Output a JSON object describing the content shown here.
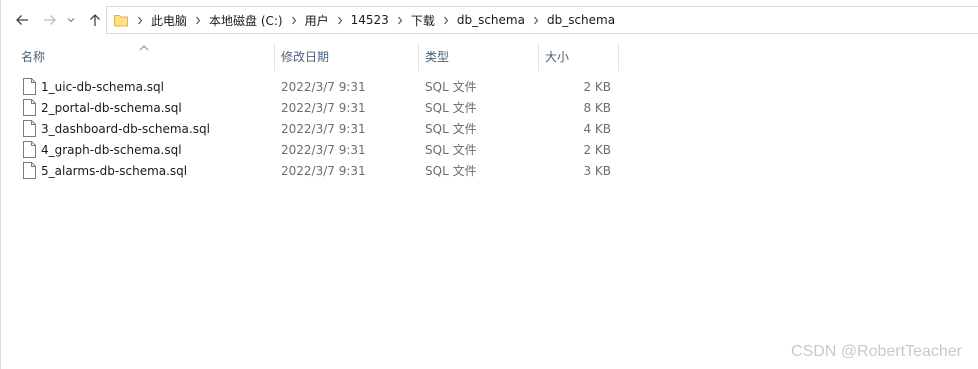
{
  "nav": {
    "breadcrumbs": [
      "此电脑",
      "本地磁盘 (C:)",
      "用户",
      "14523",
      "下载",
      "db_schema",
      "db_schema"
    ]
  },
  "columns": {
    "name": "名称",
    "date": "修改日期",
    "type": "类型",
    "size": "大小",
    "sort_column": "name"
  },
  "files": [
    {
      "name": "1_uic-db-schema.sql",
      "date": "2022/3/7 9:31",
      "type": "SQL 文件",
      "size": "2 KB"
    },
    {
      "name": "2_portal-db-schema.sql",
      "date": "2022/3/7 9:31",
      "type": "SQL 文件",
      "size": "8 KB"
    },
    {
      "name": "3_dashboard-db-schema.sql",
      "date": "2022/3/7 9:31",
      "type": "SQL 文件",
      "size": "4 KB"
    },
    {
      "name": "4_graph-db-schema.sql",
      "date": "2022/3/7 9:31",
      "type": "SQL 文件",
      "size": "2 KB"
    },
    {
      "name": "5_alarms-db-schema.sql",
      "date": "2022/3/7 9:31",
      "type": "SQL 文件",
      "size": "3 KB"
    }
  ],
  "watermark": "CSDN @RobertTeacher",
  "colors": {
    "header_text": "#4c607a",
    "folder": "#ffe08a",
    "meta_text": "#6d6d6d"
  }
}
